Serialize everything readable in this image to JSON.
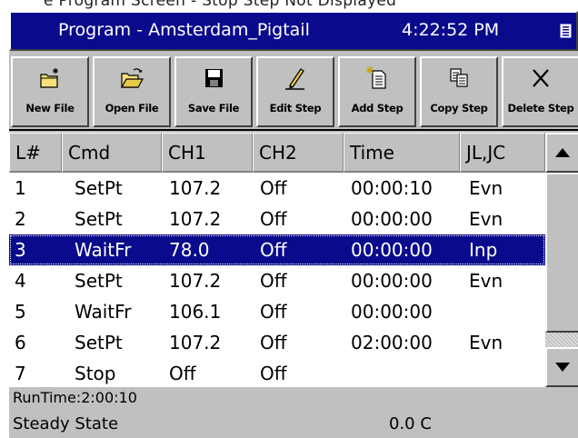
{
  "banner": {
    "text": "e Program Screen - Stop Step Not Displayed"
  },
  "titlebar": {
    "title": "Program - Amsterdam_Pigtail",
    "clock": "4:22:52 PM",
    "menu_icon": "menu-icon"
  },
  "toolbar": {
    "buttons": [
      {
        "label": "New File",
        "icon": "new-file-icon"
      },
      {
        "label": "Open File",
        "icon": "open-folder-icon"
      },
      {
        "label": "Save File",
        "icon": "floppy-disk-icon"
      },
      {
        "label": "Edit Step",
        "icon": "pencil-icon"
      },
      {
        "label": "Add Step",
        "icon": "add-document-icon"
      },
      {
        "label": "Copy Step",
        "icon": "copy-icon"
      },
      {
        "label": "Delete Step",
        "icon": "x-delete-icon"
      }
    ]
  },
  "table": {
    "columns": [
      "L#",
      "Cmd",
      "CH1",
      "CH2",
      "Time",
      "JL,JC"
    ],
    "rows": [
      {
        "l": "1",
        "cmd": "SetPt",
        "ch1": "107.2",
        "ch2": "Off",
        "time": "00:00:10",
        "jl": "Evn"
      },
      {
        "l": "2",
        "cmd": "SetPt",
        "ch1": "107.2",
        "ch2": "Off",
        "time": "00:00:00",
        "jl": "Evn"
      },
      {
        "l": "3",
        "cmd": "WaitFr",
        "ch1": "78.0",
        "ch2": "Off",
        "time": "00:00:00",
        "jl": "Inp"
      },
      {
        "l": "4",
        "cmd": "SetPt",
        "ch1": "107.2",
        "ch2": "Off",
        "time": "00:00:00",
        "jl": "Evn"
      },
      {
        "l": "5",
        "cmd": "WaitFr",
        "ch1": "106.1",
        "ch2": "Off",
        "time": "00:00:00",
        "jl": ""
      },
      {
        "l": "6",
        "cmd": "SetPt",
        "ch1": "107.2",
        "ch2": "Off",
        "time": "02:00:00",
        "jl": "Evn"
      },
      {
        "l": "7",
        "cmd": "Stop",
        "ch1": "Off",
        "ch2": "Off",
        "time": "",
        "jl": ""
      }
    ],
    "selected_row": 3
  },
  "scrollbar": {
    "up_icon": "arrow-up-icon",
    "down_icon": "arrow-down-icon"
  },
  "status": {
    "runtime": "RunTime:2:00:10",
    "state": "Steady State",
    "value": "0.0 C"
  },
  "colors": {
    "title_bar": "#0a0a8c",
    "selection": "#0a0a8c",
    "chrome": "#c0c0c0"
  }
}
